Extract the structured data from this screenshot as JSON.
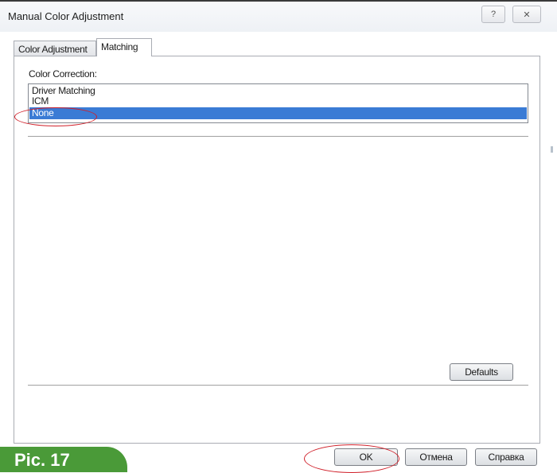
{
  "window": {
    "title": "Manual Color Adjustment"
  },
  "titlebar": {
    "help_glyph": "?",
    "close_glyph": "✕"
  },
  "tabs": [
    {
      "label": "Color Adjustment",
      "selected": false
    },
    {
      "label": "Matching",
      "selected": true
    }
  ],
  "color_correction": {
    "label": "Color Correction:",
    "options": [
      "Driver Matching",
      "ICM",
      "None"
    ],
    "selected": "None"
  },
  "buttons": {
    "defaults": "Defaults",
    "ok": "OK",
    "cancel": "Отмена",
    "help": "Справка"
  },
  "caption": {
    "label": "Pic. 17"
  },
  "colors": {
    "selection": "#3a7bd5",
    "annotation": "#d0202a",
    "caption_bg": "#4a9a38"
  }
}
